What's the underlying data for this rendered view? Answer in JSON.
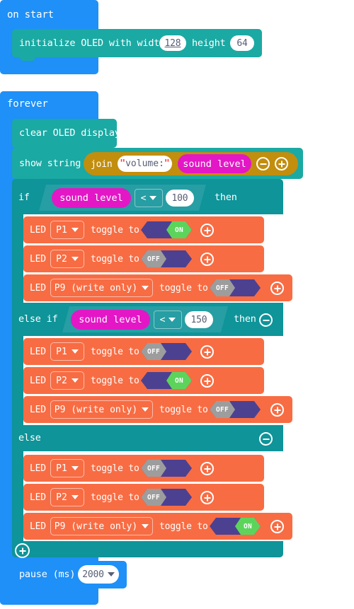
{
  "app": {
    "name": "MakeCode Blocks Editor",
    "workspace_background": "#ffffff"
  },
  "colors": {
    "event": "#1e90f7",
    "loop": "#1e90f7",
    "oled": "#1ba9a3",
    "logic": "#0e9499",
    "pin": "#f86c43",
    "variable": "#e317c6",
    "text_join": "#c28e0e",
    "toggle_base": "#4c4191",
    "toggle_on": "#5cd45c",
    "toggle_off": "#9d9d9d",
    "field_text": "#575e75"
  },
  "blocks": {
    "on_start": {
      "label": "on start",
      "children": [
        {
          "name": "initialize-oled",
          "prefix": "initialize OLED with width",
          "width_value": "128",
          "mid": "height",
          "height_value": "64"
        }
      ]
    },
    "forever": {
      "label": "forever",
      "clear_display": "clear OLED display",
      "show_string": {
        "label": "show string",
        "join_label": "join",
        "string_value": "volume:",
        "quote": "\"",
        "variable": "sound level",
        "minus_icon": "minus-circle-icon",
        "plus_icon": "plus-circle-icon"
      },
      "conditional": {
        "if_label": "if",
        "then_label": "then",
        "else_if_label": "else if",
        "else_label": "else",
        "branches": [
          {
            "id": "if",
            "condition": {
              "variable": "sound level",
              "operator": "<",
              "value": "100"
            },
            "statements": [
              {
                "prefix": "LED",
                "pin": "P1",
                "mid": "toggle to",
                "state": "ON"
              },
              {
                "prefix": "LED",
                "pin": "P2",
                "mid": "toggle to",
                "state": "OFF"
              },
              {
                "prefix": "LED",
                "pin": "P9 (write only)",
                "mid": "toggle to",
                "state": "OFF"
              }
            ]
          },
          {
            "id": "else-if",
            "condition": {
              "variable": "sound level",
              "operator": "<",
              "value": "150"
            },
            "statements": [
              {
                "prefix": "LED",
                "pin": "P1",
                "mid": "toggle to",
                "state": "OFF"
              },
              {
                "prefix": "LED",
                "pin": "P2",
                "mid": "toggle to",
                "state": "ON"
              },
              {
                "prefix": "LED",
                "pin": "P9 (write only)",
                "mid": "toggle to",
                "state": "OFF"
              }
            ]
          },
          {
            "id": "else",
            "condition": null,
            "statements": [
              {
                "prefix": "LED",
                "pin": "P1",
                "mid": "toggle to",
                "state": "OFF"
              },
              {
                "prefix": "LED",
                "pin": "P2",
                "mid": "toggle to",
                "state": "OFF"
              },
              {
                "prefix": "LED",
                "pin": "P9 (write only)",
                "mid": "toggle to",
                "state": "ON"
              }
            ]
          }
        ],
        "add_branch_icon": "plus-circle-icon",
        "remove_branch_icon": "minus-circle-icon"
      },
      "pause": {
        "label": "pause (ms)",
        "value": "2000"
      }
    }
  }
}
